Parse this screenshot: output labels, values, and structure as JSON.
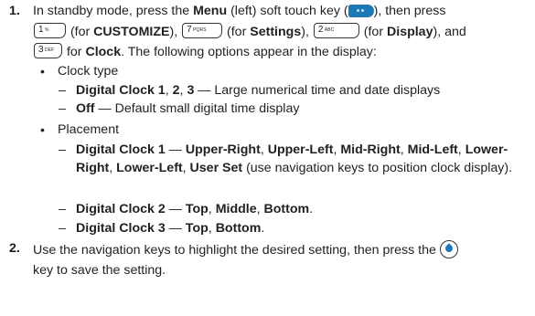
{
  "step1": {
    "number": "1.",
    "t1": "In standby mode, press the ",
    "menu": "Menu",
    "t2": " (left) soft touch key (",
    "t3": "), then press",
    "key1_digit": "1",
    "key1_sub": "%",
    "t4": " (for ",
    "customize": "CUSTOMIZE",
    "t5": "), ",
    "key7_digit": "7",
    "key7_sub": "PQRS",
    "t6": " (for ",
    "settings": "Settings",
    "t7": "), ",
    "key2_digit": "2",
    "key2_sub": "ABC",
    "t8": " (for ",
    "display": "Display",
    "t9": "), and",
    "key3_digit": "3",
    "key3_sub": "DEF",
    "t10": " for ",
    "clock": "Clock",
    "t11": ". The following options appear in the display:"
  },
  "bullet1": {
    "symbol": "•",
    "label": "Clock type"
  },
  "clocktype": {
    "dash": "–",
    "d1_b1": "Digital Clock 1",
    "d1_sep1": ", ",
    "d1_b2": "2",
    "d1_sep2": ", ",
    "d1_b3": "3",
    "d1_rest": " — Large numerical time and date displays",
    "d2_b": "Off",
    "d2_rest": " — Default small digital time display"
  },
  "bullet2": {
    "symbol": "•",
    "label": "Placement"
  },
  "placement": {
    "p1_b": "Digital Clock 1",
    "p1_dash": " — ",
    "p1_o1": "Upper-Right",
    "p1_o2": "Upper-Left",
    "p1_o3": "Mid-Right",
    "p1_o4": "Mid-Left",
    "p1_o5": "Lower-Right",
    "p1_o6": "Lower-Left",
    "p1_o7": "User Set",
    "p1_rest": " (use navigation keys to position clock display).",
    "p2_b": "Digital Clock 2",
    "p2_o1": "Top",
    "p2_o2": "Middle",
    "p2_o3": "Bottom",
    "p3_b": "Digital Clock 3",
    "p3_o1": "Top",
    "p3_o2": "Bottom",
    "comma": ", ",
    "period": "."
  },
  "step2": {
    "number": "2.",
    "t1": "Use the navigation keys to highlight the desired setting, then press the ",
    "t2": "key to save the setting."
  },
  "icons": {
    "softkey": "menu-soft-key-icon",
    "ok": "ok-key-icon"
  },
  "colors": {
    "text": "#231f20",
    "key_blue": "#1e78b6"
  }
}
